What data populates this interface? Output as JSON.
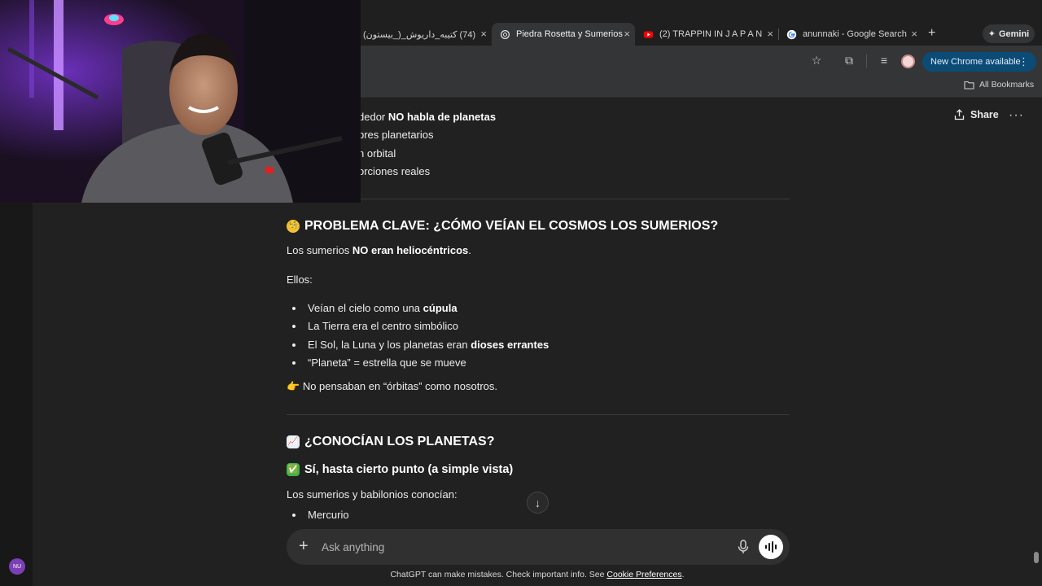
{
  "browser": {
    "tabs": [
      {
        "title": "(74) کتیبه_داریوش_(_بیستون)"
      },
      {
        "title": "Piedra Rosetta y Sumerios",
        "active": true
      },
      {
        "title": "(2) TRAPPIN IN  J A P A N"
      },
      {
        "title": "anunnaki - Google Search"
      }
    ],
    "gemini_label": "Gemini",
    "update_label": "New Chrome available",
    "bookmarks_label": "All Bookmarks"
  },
  "chat": {
    "share_label": "Share",
    "top_fragments": [
      {
        "plain": "dedor ",
        "bold": "NO habla de planetas"
      },
      {
        "plain": "bres planetarios",
        "bold": ""
      },
      {
        "plain": "n orbital",
        "bold": ""
      },
      {
        "plain": "orciones reales",
        "bold": ""
      }
    ],
    "section1": {
      "emoji": "🧐",
      "heading": "PROBLEMA CLAVE: ¿CÓMO VEÍAN EL COSMOS LOS SUMERIOS?",
      "intro_plain": "Los sumerios ",
      "intro_bold": "NO eran heliocéntricos",
      "intro_end": ".",
      "ellos": "Ellos:",
      "bullets": [
        {
          "plain": "Veían el cielo como una ",
          "bold": "cúpula"
        },
        {
          "plain": "La Tierra era el centro simbólico",
          "bold": ""
        },
        {
          "plain": "El Sol, la Luna y los planetas eran ",
          "bold": "dioses errantes"
        },
        {
          "plain": "“Planeta” = estrella que se mueve",
          "bold": ""
        }
      ],
      "note_emoji": "👉",
      "note": "No pensaban en “órbitas” como nosotros."
    },
    "section2": {
      "emoji": "📈",
      "heading": "¿CONOCÍAN LOS PLANETAS?",
      "sub_emoji": "✅",
      "subheading": "Sí, hasta cierto punto (a simple vista)",
      "intro": "Los sumerios y babilonios conocían:",
      "bullets": [
        "Mercurio"
      ]
    },
    "composer_placeholder": "Ask anything",
    "disclaimer_text": "ChatGPT can make mistakes. Check important info. See ",
    "disclaimer_link": "Cookie Preferences",
    "disclaimer_end": ".",
    "user_initials": "NU"
  },
  "colors": {
    "page_bg": "#212121",
    "composer_bg": "#303030",
    "update_button": "#0c4b76"
  }
}
